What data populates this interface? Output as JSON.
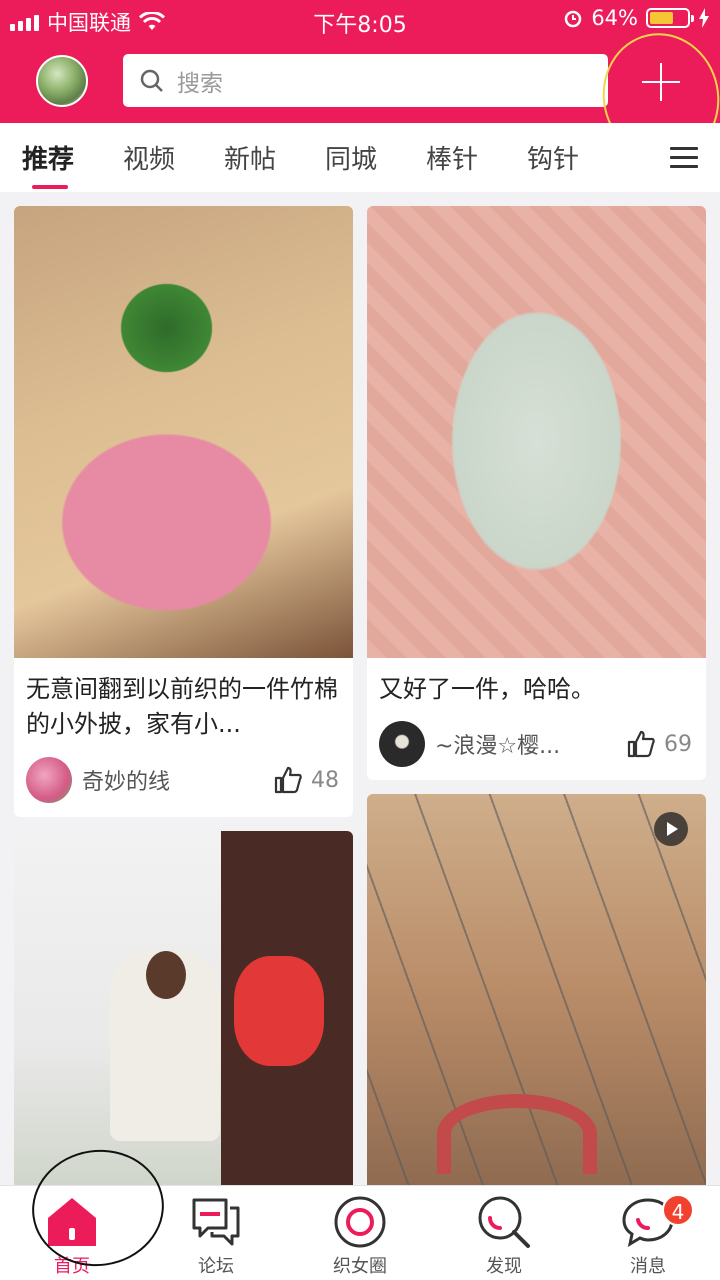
{
  "status_bar": {
    "carrier": "中国联通",
    "time": "下午8:05",
    "battery": "64%",
    "battery_level": 0.64
  },
  "header": {
    "search_placeholder": "搜索",
    "icons": [
      "search-icon",
      "plus-icon"
    ]
  },
  "tabs": [
    {
      "label": "推荐",
      "active": true
    },
    {
      "label": "视频"
    },
    {
      "label": "新帖"
    },
    {
      "label": "同城"
    },
    {
      "label": "棒针"
    },
    {
      "label": "钩针"
    }
  ],
  "cards": [
    {
      "title": "无意间翻到以前织的一件竹棉的小外披，家有小...",
      "author": "奇妙的线",
      "likes": "48"
    },
    {
      "title": "又好了一件，哈哈。",
      "author": "~浪漫☆樱...",
      "likes": "69"
    },
    {
      "has_video": false
    },
    {
      "has_video": true
    }
  ],
  "bottom_nav": [
    {
      "label": "首页",
      "icon": "home-icon",
      "active": true
    },
    {
      "label": "论坛",
      "icon": "forum-icon"
    },
    {
      "label": "织女圈",
      "icon": "circle-icon"
    },
    {
      "label": "发现",
      "icon": "discover-icon"
    },
    {
      "label": "消息",
      "icon": "message-icon",
      "badge": "4"
    }
  ],
  "colors": {
    "brand": "#ec1c5b",
    "badge": "#f2412e"
  }
}
